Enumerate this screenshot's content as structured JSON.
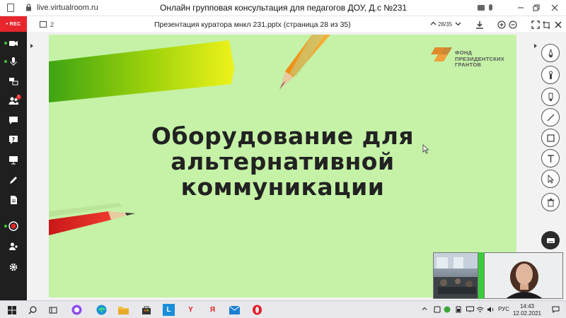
{
  "browser": {
    "url": "live.virtualroom.ru",
    "title": "Онлайн групповая консультация для педагогов ДОУ, Д.с №231",
    "minimize_icon": "minimize-icon",
    "maximize_icon": "maximize-icon",
    "close_icon": "close-icon"
  },
  "sidebar": {
    "rec_label": "• REC",
    "items": [
      {
        "icon": "camera-icon",
        "active": true
      },
      {
        "icon": "microphone-icon",
        "active": true
      },
      {
        "icon": "screen-share-icon"
      },
      {
        "icon": "participants-icon",
        "badge": "1"
      },
      {
        "icon": "chat-icon"
      },
      {
        "icon": "question-icon"
      },
      {
        "icon": "presentation-icon"
      },
      {
        "icon": "pen-icon"
      },
      {
        "icon": "document-icon"
      },
      {
        "icon": "record-icon",
        "active": true
      },
      {
        "icon": "add-user-icon"
      },
      {
        "icon": "settings-icon"
      }
    ]
  },
  "toolbar": {
    "pages_count": "2",
    "presentation_title": "Презентация куратора мнкл 231.pptx (страница 28 из 35)",
    "page_indicator": "28/35"
  },
  "slide": {
    "line1": "Оборудование для",
    "line2": "альтернативной",
    "line3": "коммуникации",
    "logo_line1": "ФОНД",
    "logo_line2": "ПРЕЗИДЕНТСКИХ",
    "logo_line3": "ГРАНТОВ"
  },
  "tools": [
    "pencil-icon",
    "brush-icon",
    "marker-icon",
    "line-icon",
    "rectangle-icon",
    "text-icon",
    "pointer-icon",
    "trash-icon",
    "keyboard-icon"
  ],
  "taskbar": {
    "apps": [
      "windows-start-icon",
      "search-icon",
      "task-view-icon",
      "alice-icon",
      "edge-icon",
      "file-explorer-icon",
      "store-icon",
      "l-app-icon",
      "yandex-browser-icon",
      "yandex-icon",
      "mail-icon",
      "opera-icon"
    ],
    "language": "РУС",
    "time": "14:43",
    "date": "12.02.2021"
  },
  "colors": {
    "sidebar_bg": "#1f1f1f",
    "rec_red": "#e7262d",
    "slide_bg": "#c5f2a7",
    "active_green": "#3ccb3c"
  }
}
